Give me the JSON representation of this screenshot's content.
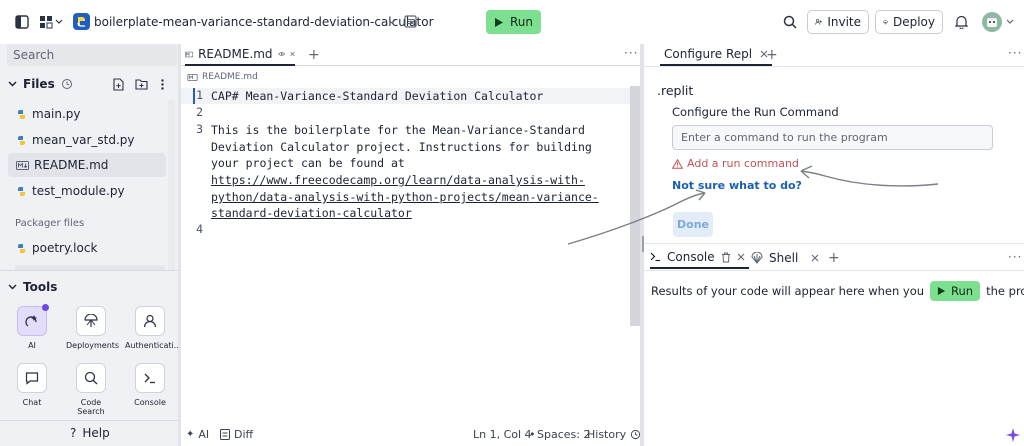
{
  "topbar": {
    "repl_name": "boilerplate-mean-variance-standard-deviation-calculator",
    "run_label": "Run",
    "invite_label": "Invite",
    "deploy_label": "Deploy"
  },
  "sidebar": {
    "search_placeholder": "Search",
    "files_title": "Files",
    "files": [
      {
        "name": "main.py",
        "icon": "python-icon"
      },
      {
        "name": "mean_var_std.py",
        "icon": "python-icon"
      },
      {
        "name": "README.md",
        "icon": "markdown-icon"
      },
      {
        "name": "test_module.py",
        "icon": "python-icon"
      }
    ],
    "packager_title": "Packager files",
    "packager_files": [
      {
        "name": "poetry.lock"
      }
    ],
    "tools_title": "Tools",
    "tools": [
      {
        "label": "AI",
        "icon": "ai-icon"
      },
      {
        "label": "Deployments",
        "icon": "deployments-icon"
      },
      {
        "label": "Authenticati...",
        "icon": "user-icon"
      },
      {
        "label": "Chat",
        "icon": "chat-icon"
      },
      {
        "label": "Code Search",
        "icon": "search-icon"
      },
      {
        "label": "Console",
        "icon": "terminal-icon"
      }
    ],
    "help_label": "Help"
  },
  "editor": {
    "tab_label": "README.md",
    "breadcrumb": "README.md",
    "lines": [
      {
        "n": "1",
        "text": "CAP# Mean-Variance-Standard Deviation Calculator"
      },
      {
        "n": "2",
        "text": ""
      },
      {
        "n": "3",
        "text": "This is the boilerplate for the Mean-Variance-Standard"
      },
      {
        "n": "",
        "text": "Deviation Calculator project. Instructions for building"
      },
      {
        "n": "",
        "text": "your project can be found at"
      },
      {
        "n": "",
        "text": "https://www.freecodecamp.org/learn/data-analysis-with-",
        "link": true
      },
      {
        "n": "",
        "text": "python/data-analysis-with-python-projects/mean-variance-",
        "link": true
      },
      {
        "n": "",
        "text": "standard-deviation-calculator",
        "link": true
      },
      {
        "n": "4",
        "text": ""
      }
    ],
    "status": {
      "ai": "AI",
      "diff": "Diff",
      "position": "Ln 1, Col 4",
      "spaces": "Spaces: 2",
      "history": "History"
    }
  },
  "configure": {
    "tab_label": "Configure Repl",
    "section": ".replit",
    "label": "Configure the Run Command",
    "input_placeholder": "Enter a command to run the program",
    "warning": "Add a run command",
    "help_link": "Not sure what to do?",
    "done_label": "Done"
  },
  "console": {
    "tab_console": "Console",
    "tab_shell": "Shell",
    "message_before": "Results of your code will appear here when you",
    "run_label": "Run",
    "message_after": "the project."
  },
  "colors": {
    "run_green": "#7ddf90",
    "warning_red": "#c55353",
    "link_blue": "#1c5fb0",
    "done_bg": "#e2edf8"
  }
}
